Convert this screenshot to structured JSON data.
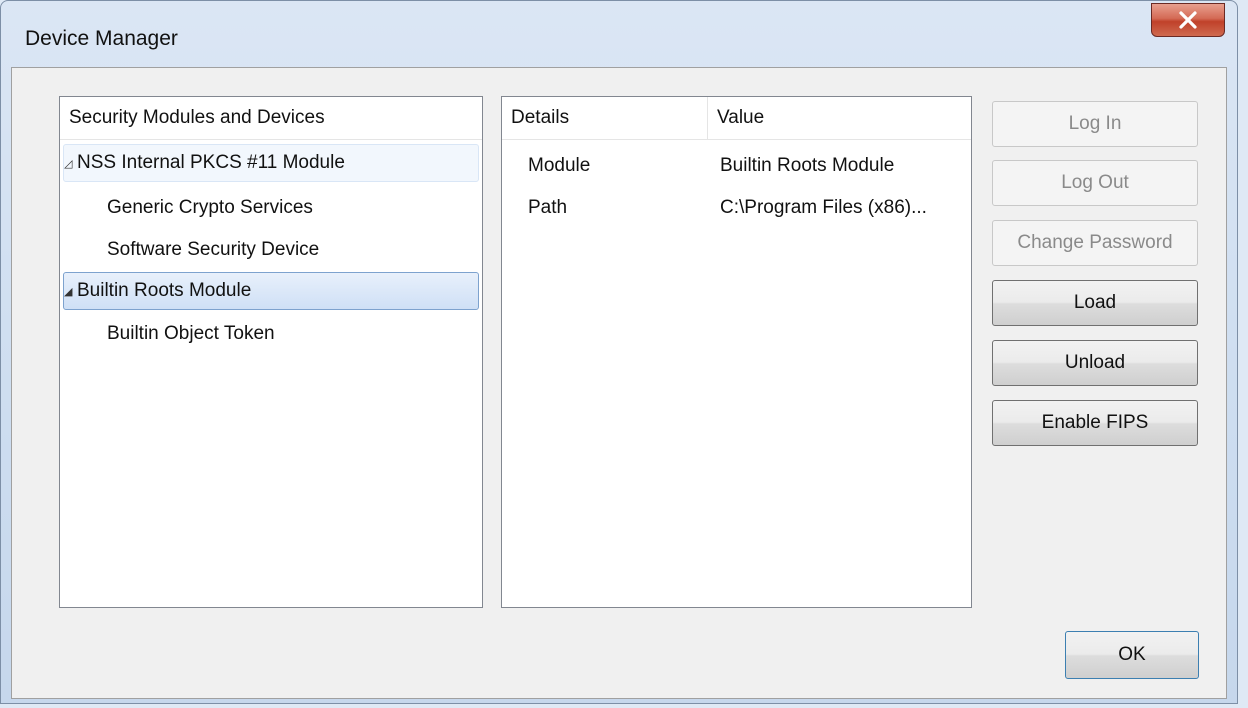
{
  "window": {
    "title": "Device Manager",
    "close_glyph": "X"
  },
  "tree": {
    "header": "Security Modules and Devices",
    "items": [
      {
        "label": "NSS Internal PKCS #11 Module",
        "level": 0,
        "expanded": true
      },
      {
        "label": "Generic Crypto Services",
        "level": 1
      },
      {
        "label": "Software Security Device",
        "level": 1
      },
      {
        "label": "Builtin Roots Module",
        "level": 0,
        "expanded": true,
        "selected": true
      },
      {
        "label": "Builtin Object Token",
        "level": 1
      }
    ]
  },
  "details": {
    "columns": [
      "Details",
      "Value"
    ],
    "rows": [
      {
        "detail": "Module",
        "value": "Builtin Roots Module"
      },
      {
        "detail": "Path",
        "value": "C:\\Program Files (x86)..."
      }
    ]
  },
  "buttons": {
    "log_in": "Log In",
    "log_out": "Log Out",
    "change_password": "Change Password",
    "load": "Load",
    "unload": "Unload",
    "enable_fips": "Enable FIPS",
    "ok": "OK"
  },
  "icons": {
    "expand_hollow": "expand-arrow-icon",
    "expand_filled": "expanded-arrow-icon",
    "close": "close-icon"
  },
  "colors": {
    "close_button": "#c0412a",
    "selection_border": "#7da2ce"
  }
}
